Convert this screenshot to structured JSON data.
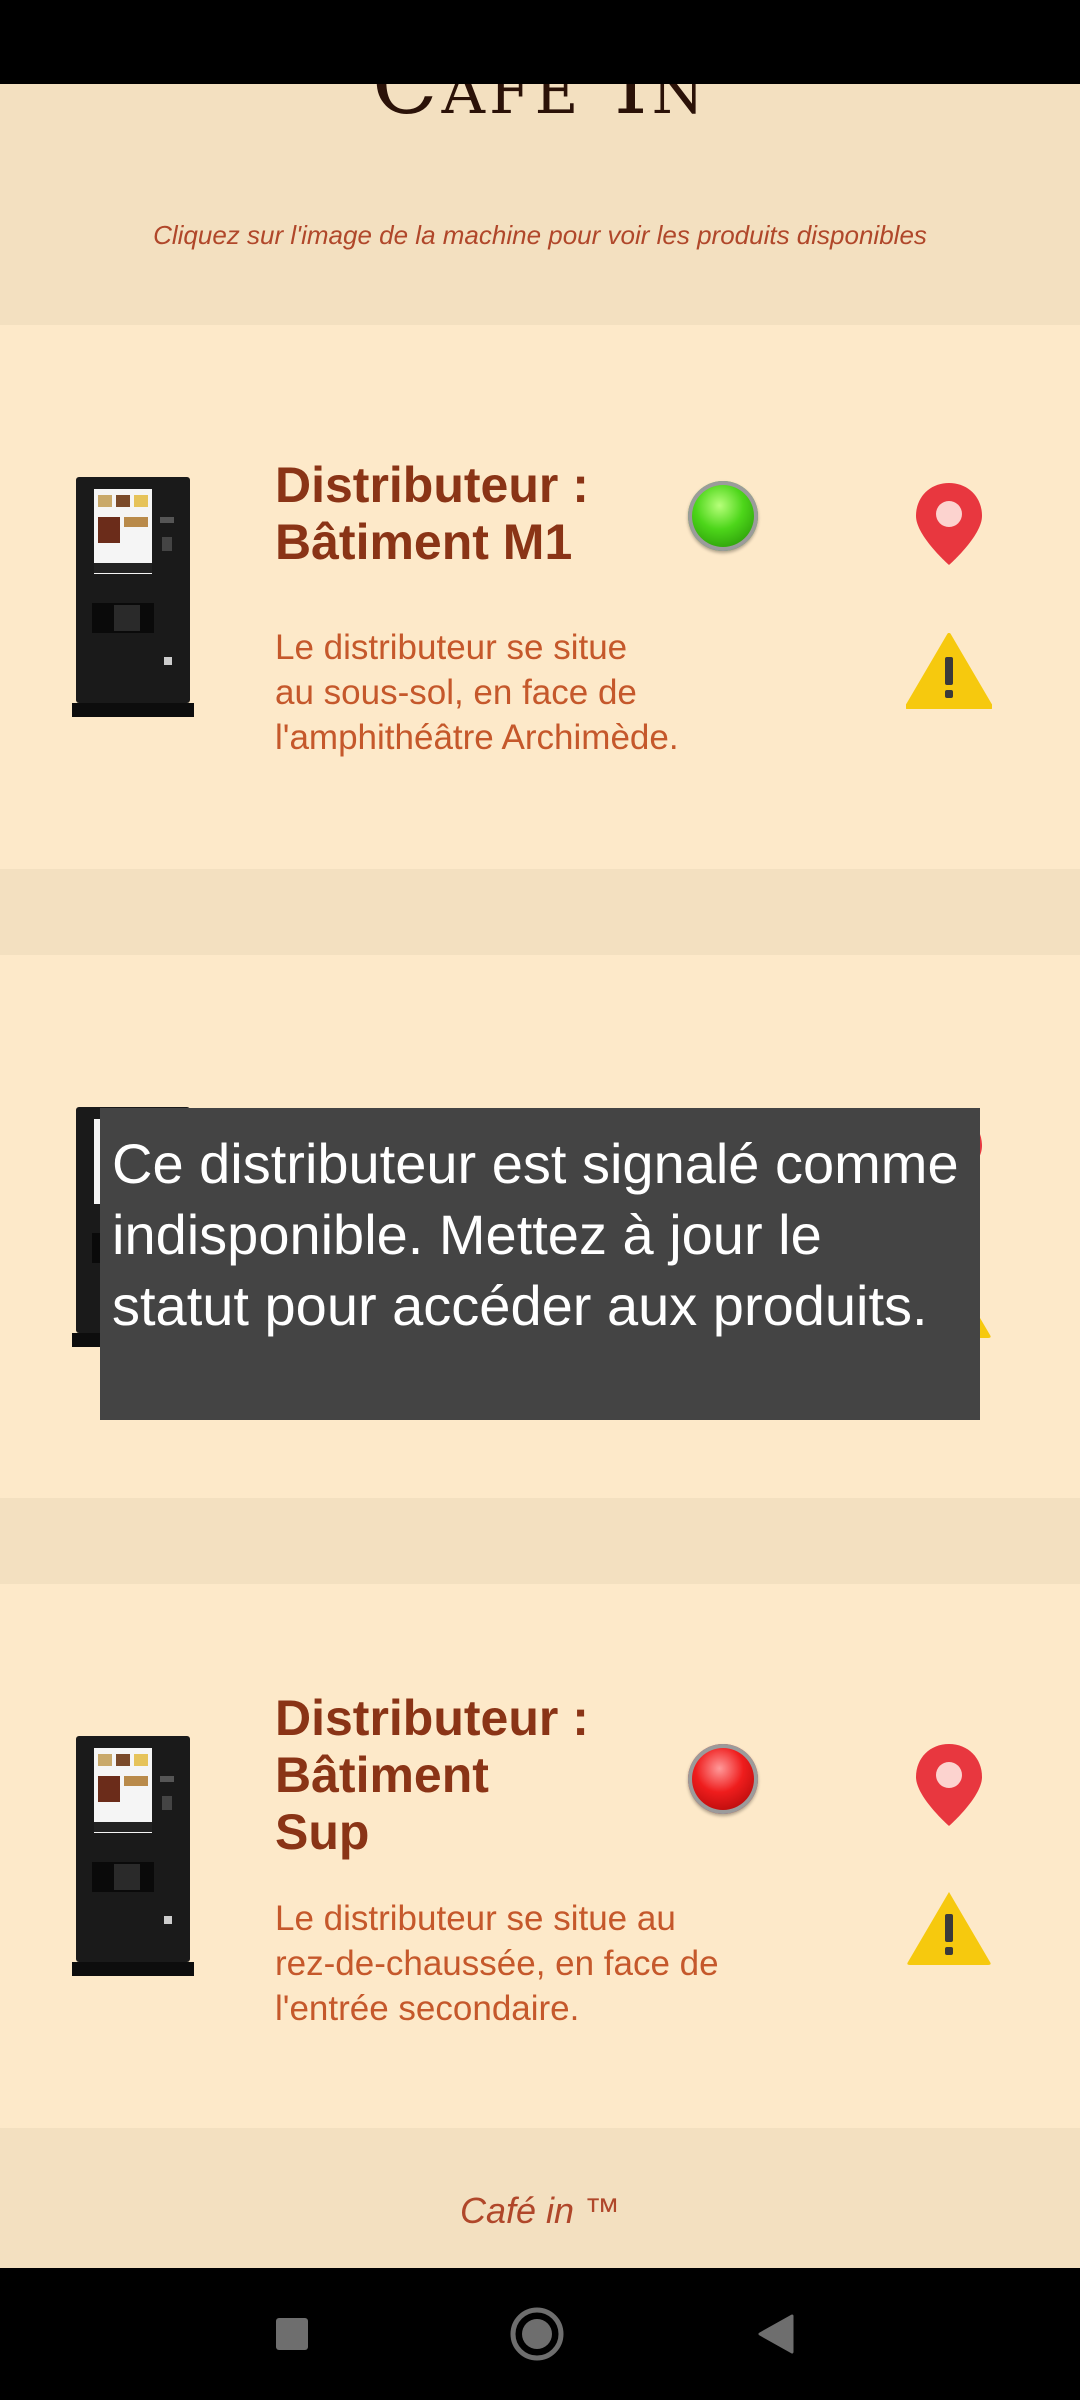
{
  "header": {
    "title": "Café In",
    "subtitle": "Cliquez sur l'image de la machine pour voir les produits disponibles"
  },
  "machines": [
    {
      "title_line1": "Distributeur :",
      "title_line2": "Bâtiment M1",
      "description_lines": [
        "Le distributeur se situe",
        "au sous-sol, en face de",
        "l'amphithéâtre Archimède."
      ],
      "status": "available",
      "status_color": "#3cc512"
    },
    {
      "status": "unavailable-hidden-by-toast"
    },
    {
      "title_line1": "Distributeur :",
      "title_line2": "Bâtiment",
      "title_line3": "Sup",
      "description_lines": [
        "Le distributeur se situe au",
        "rez-de-chaussée, en face de",
        "l'entrée secondaire."
      ],
      "status": "unavailable",
      "status_color": "#e01010"
    }
  ],
  "toast": {
    "message": "Ce distributeur est signalé comme indisponible. Mettez à jour le statut pour accéder aux produits."
  },
  "footer": {
    "text": "Café in ™"
  },
  "colors": {
    "page_bg": "#f3e0c0",
    "card_bg": "#fde9c9",
    "title_brown": "#8a3416",
    "desc_orange": "#c5582b",
    "pin_red": "#e8373f",
    "warn_yellow": "#f6c90e"
  },
  "icons": {
    "location": "map-pin-icon",
    "report": "warning-icon",
    "nav_recents": "square-icon",
    "nav_home": "circle-icon",
    "nav_back": "triangle-back-icon"
  }
}
